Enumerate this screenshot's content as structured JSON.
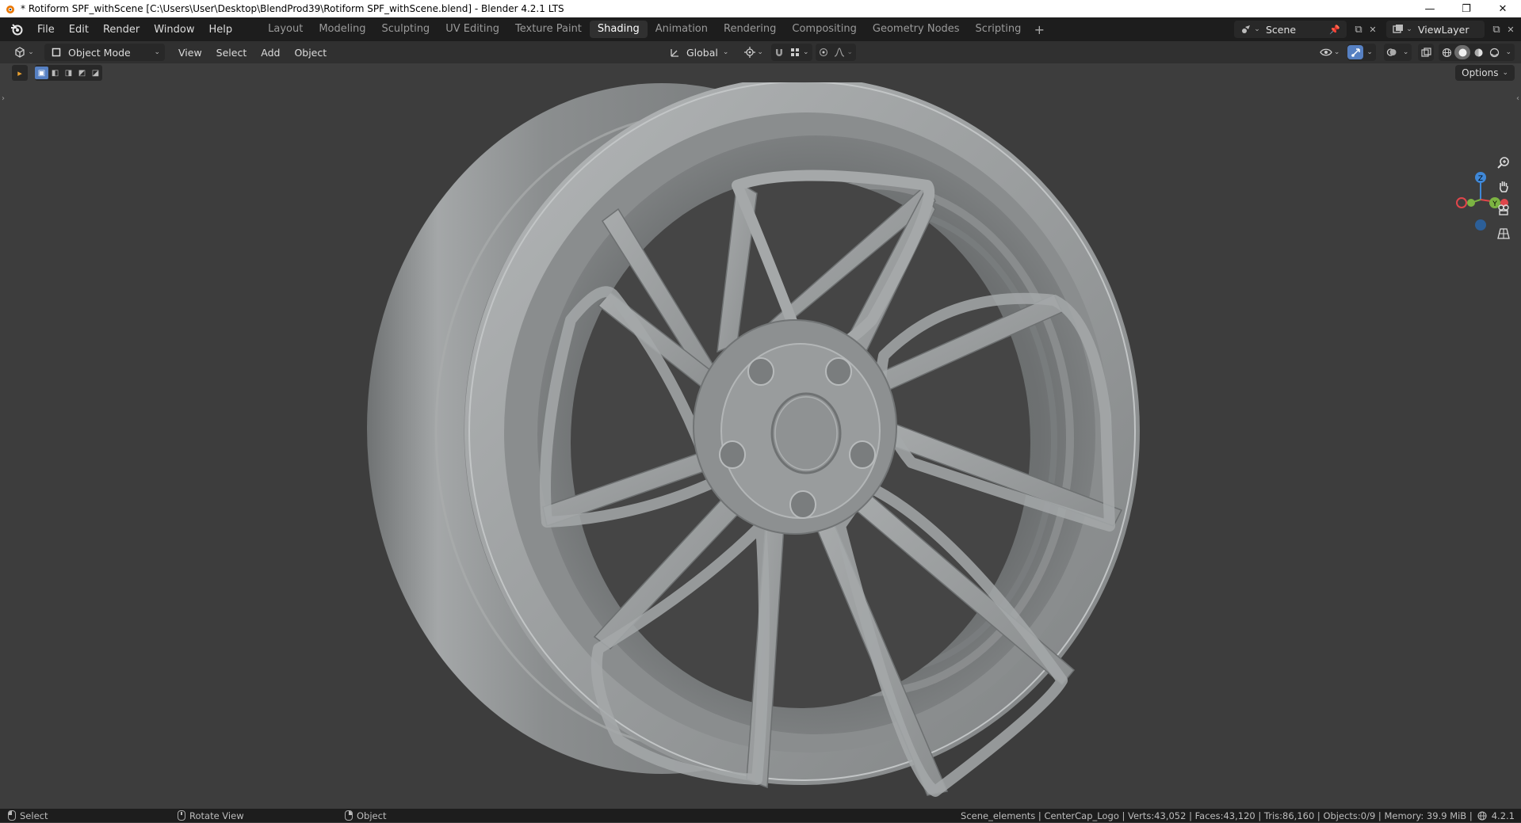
{
  "window": {
    "title": "* Rotiform SPF_withScene [C:\\Users\\User\\Desktop\\BlendProd39\\Rotiform SPF_withScene.blend] - Blender 4.2.1 LTS",
    "minimize": "—",
    "maximize": "❐",
    "close": "✕"
  },
  "menubar": {
    "items": [
      "File",
      "Edit",
      "Render",
      "Window",
      "Help"
    ]
  },
  "workspaces": {
    "tabs": [
      "Layout",
      "Modeling",
      "Sculpting",
      "UV Editing",
      "Texture Paint",
      "Shading",
      "Animation",
      "Rendering",
      "Compositing",
      "Geometry Nodes",
      "Scripting"
    ],
    "active": "Shading",
    "add": "+"
  },
  "scene": {
    "name": "Scene"
  },
  "view_layer": {
    "name": "ViewLayer"
  },
  "viewport_header": {
    "mode": "Object Mode",
    "menus": [
      "View",
      "Select",
      "Add",
      "Object"
    ],
    "transform_orientation": "Global"
  },
  "toolbar": {
    "options_label": "Options"
  },
  "gizmo": {
    "z_label": "Z",
    "y_label": "Y",
    "x_label": "X"
  },
  "statusbar": {
    "left_mouse": "Select",
    "middle_mouse": "Rotate View",
    "right_mouse": "Object",
    "stats": "Scene_elements | CenterCap_Logo | Verts:43,052 | Faces:43,120 | Tris:86,160 | Objects:0/9 | Memory: 39.9 MiB |",
    "version": "4.2.1"
  },
  "colors": {
    "accent": "#5680c2",
    "axis_x": "#e0464b",
    "axis_y": "#7cb342",
    "axis_z": "#3f88d8",
    "viewport_bg": "#3d3d3d",
    "wheel": "#8f9293"
  }
}
